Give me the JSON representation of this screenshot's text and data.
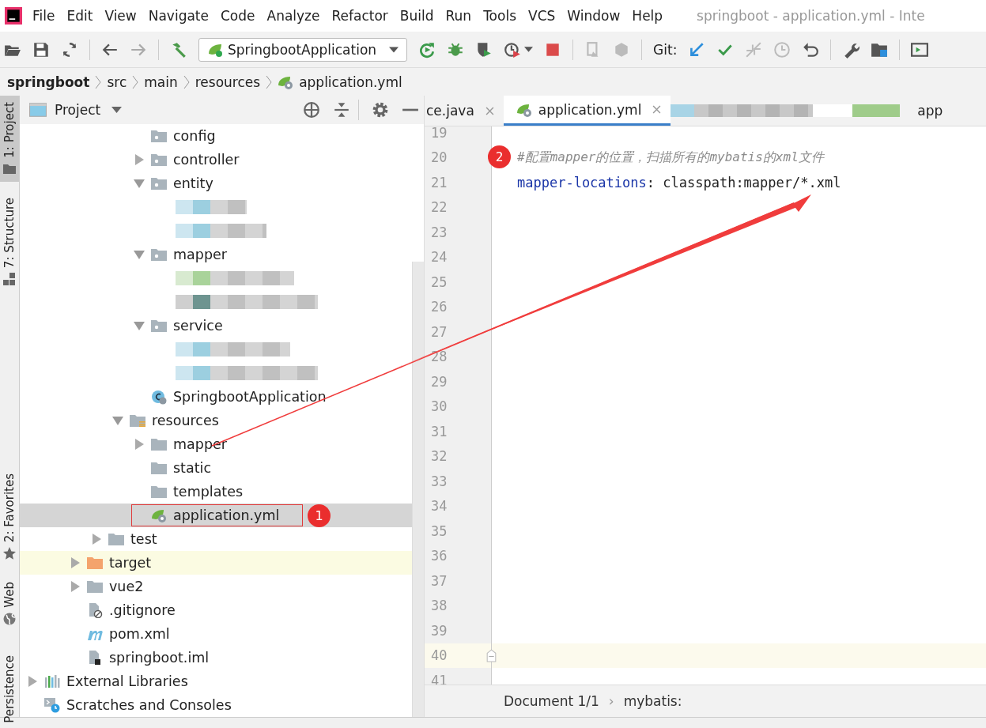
{
  "menu": [
    "File",
    "Edit",
    "View",
    "Navigate",
    "Code",
    "Analyze",
    "Refactor",
    "Build",
    "Run",
    "Tools",
    "VCS",
    "Window",
    "Help"
  ],
  "window": {
    "title": "springboot - application.yml - Inte"
  },
  "toolbar": {
    "run_config": "SpringbootApplication",
    "git_label": "Git:"
  },
  "breadcrumb": [
    {
      "label": "springboot",
      "kind": "root"
    },
    {
      "label": "src",
      "kind": "dir"
    },
    {
      "label": "main",
      "kind": "dir"
    },
    {
      "label": "resources",
      "kind": "dir"
    },
    {
      "label": "application.yml",
      "kind": "yaml"
    }
  ],
  "side_tabs": [
    {
      "label": "1: Project",
      "selected": true,
      "kind": "project"
    },
    {
      "label": "7: Structure",
      "selected": false,
      "kind": "structure"
    },
    {
      "label": "2: Favorites",
      "selected": false,
      "kind": "favorites"
    },
    {
      "label": "Web",
      "selected": false,
      "kind": "web"
    },
    {
      "label": "Persistence",
      "selected": false,
      "kind": "persistence"
    }
  ],
  "project_panel": {
    "title": "Project",
    "tree": [
      {
        "children": [
          {
            "children": [
              {
                "children": [
                  {
                    "children": [
                      {
                        "children": [
                          {
                            "label": "config",
                            "kind": "package",
                            "selected": false
                          },
                          {
                            "label": "controller",
                            "kind": "package",
                            "expanded": false,
                            "selected": false
                          },
                          {
                            "label": "entity",
                            "kind": "package",
                            "expanded": true,
                            "selected": false,
                            "children": [
                              {
                                "kind": "redacted"
                              },
                              {
                                "kind": "redacted"
                              }
                            ]
                          },
                          {
                            "label": "mapper",
                            "kind": "package",
                            "expanded": true,
                            "selected": false,
                            "children": [
                              {
                                "kind": "redacted"
                              },
                              {
                                "kind": "redacted"
                              }
                            ]
                          },
                          {
                            "label": "service",
                            "kind": "package",
                            "expanded": true,
                            "selected": false,
                            "children": [
                              {
                                "kind": "redacted"
                              },
                              {
                                "kind": "redacted"
                              }
                            ]
                          },
                          {
                            "label": "SpringbootApplication",
                            "kind": "spring-class",
                            "selected": false
                          }
                        ]
                      },
                      {
                        "label": "resources",
                        "kind": "resources",
                        "expanded": true,
                        "selected": false,
                        "children": [
                          {
                            "label": "mapper",
                            "kind": "folder",
                            "expanded": false,
                            "selected": false
                          },
                          {
                            "label": "static",
                            "kind": "folder",
                            "selected": false
                          },
                          {
                            "label": "templates",
                            "kind": "folder",
                            "selected": false
                          },
                          {
                            "label": "application.yml",
                            "kind": "yaml",
                            "selected": true,
                            "annotation": "1"
                          }
                        ]
                      }
                    ]
                  },
                  {
                    "label": "test",
                    "kind": "folder",
                    "expanded": false,
                    "selected": false
                  }
                ]
              },
              {
                "label": "target",
                "kind": "excluded",
                "expanded": false,
                "selected": false
              },
              {
                "label": "vue2",
                "kind": "folder",
                "expanded": false,
                "selected": false
              },
              {
                "label": ".gitignore",
                "kind": "gitignore",
                "selected": false
              },
              {
                "label": "pom.xml",
                "kind": "maven",
                "selected": false
              },
              {
                "label": "springboot.iml",
                "kind": "iml",
                "selected": false
              }
            ]
          }
        ]
      },
      {
        "label": "External Libraries",
        "kind": "libraries",
        "expanded": false,
        "selected": false
      },
      {
        "label": "Scratches and Consoles",
        "kind": "scratches",
        "selected": false
      }
    ]
  },
  "editor": {
    "tabs": [
      {
        "label": "ce.java",
        "kind": "java",
        "selected": false
      },
      {
        "label": "application.yml",
        "kind": "yaml",
        "selected": true
      },
      {
        "kind": "redacted",
        "selected": false
      },
      {
        "label": "app",
        "kind": "cut",
        "selected": false
      }
    ],
    "lines": [
      {
        "number": "19",
        "current": false
      },
      {
        "number": "20",
        "current": false,
        "comment": "#配置mapper的位置，扫描所有的mybatis的xml文件",
        "annotation": "2"
      },
      {
        "number": "21",
        "current": false,
        "key": "mapper-locations",
        "separator": ":",
        "value": "classpath:mapper/*.xml"
      },
      {
        "number": "22",
        "current": false
      },
      {
        "number": "23",
        "current": false
      },
      {
        "number": "24",
        "current": false
      },
      {
        "number": "25",
        "current": false
      },
      {
        "number": "26",
        "current": false
      },
      {
        "number": "27",
        "current": false
      },
      {
        "number": "28",
        "current": false
      },
      {
        "number": "29",
        "current": false
      },
      {
        "number": "30",
        "current": false
      },
      {
        "number": "31",
        "current": false
      },
      {
        "number": "32",
        "current": false
      },
      {
        "number": "33",
        "current": false
      },
      {
        "number": "34",
        "current": false
      },
      {
        "number": "35",
        "current": false
      },
      {
        "number": "36",
        "current": false
      },
      {
        "number": "37",
        "current": false
      },
      {
        "number": "38",
        "current": false
      },
      {
        "number": "39",
        "current": false
      },
      {
        "number": "40",
        "current": true
      },
      {
        "number": "41",
        "current": false
      }
    ],
    "footer": {
      "document": "Document 1/1",
      "separator": "›",
      "path": "mybatis:"
    }
  }
}
